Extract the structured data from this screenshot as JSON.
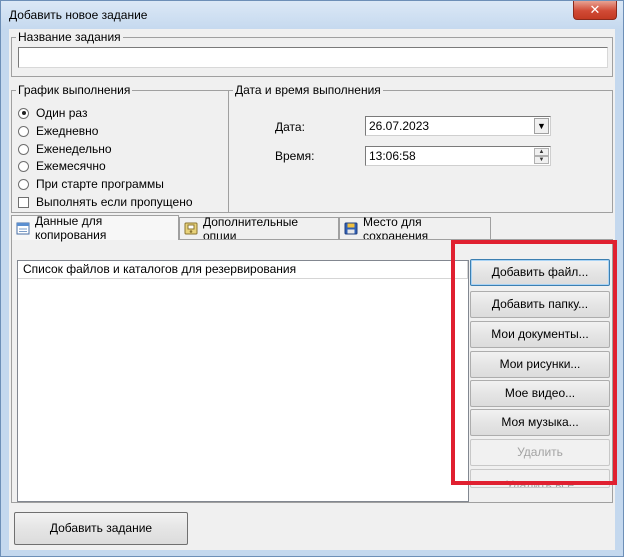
{
  "window": {
    "title": "Добавить новое задание",
    "close_label": "✕"
  },
  "task_name": {
    "group_label": "Название задания",
    "value": ""
  },
  "schedule": {
    "group_label": "График выполнения",
    "options": [
      {
        "label": "Один раз",
        "selected": true
      },
      {
        "label": "Ежедневно",
        "selected": false
      },
      {
        "label": "Еженедельно",
        "selected": false
      },
      {
        "label": "Ежемесячно",
        "selected": false
      },
      {
        "label": "При старте программы",
        "selected": false
      }
    ],
    "run_if_missed_label": "Выполнять если пропущено",
    "run_if_missed_checked": false
  },
  "datetime": {
    "group_label": "Дата и время выполнения",
    "date_label": "Дата:",
    "date_value": "26.07.2023",
    "time_label": "Время:",
    "time_value": "13:06:58"
  },
  "tabs": [
    {
      "label": "Данные для копирования",
      "icon": "data-sheet-icon",
      "active": true
    },
    {
      "label": "Дополнительные опции",
      "icon": "options-icon",
      "active": false
    },
    {
      "label": "Место для сохранения",
      "icon": "save-disk-icon",
      "active": false
    }
  ],
  "file_list": {
    "header": "Список файлов и каталогов для резервирования"
  },
  "side_buttons": {
    "add_file": "Добавить файл...",
    "add_folder": "Добавить папку...",
    "my_documents": "Мои документы...",
    "my_pictures": "Мои рисунки...",
    "my_video": "Мое видео...",
    "my_music": "Моя музыка...",
    "delete": "Удалить",
    "delete_all": "Удалить все"
  },
  "footer": {
    "add_task": "Добавить задание"
  },
  "colors": {
    "highlight": "#e02030",
    "close_button": "#d14a35"
  }
}
